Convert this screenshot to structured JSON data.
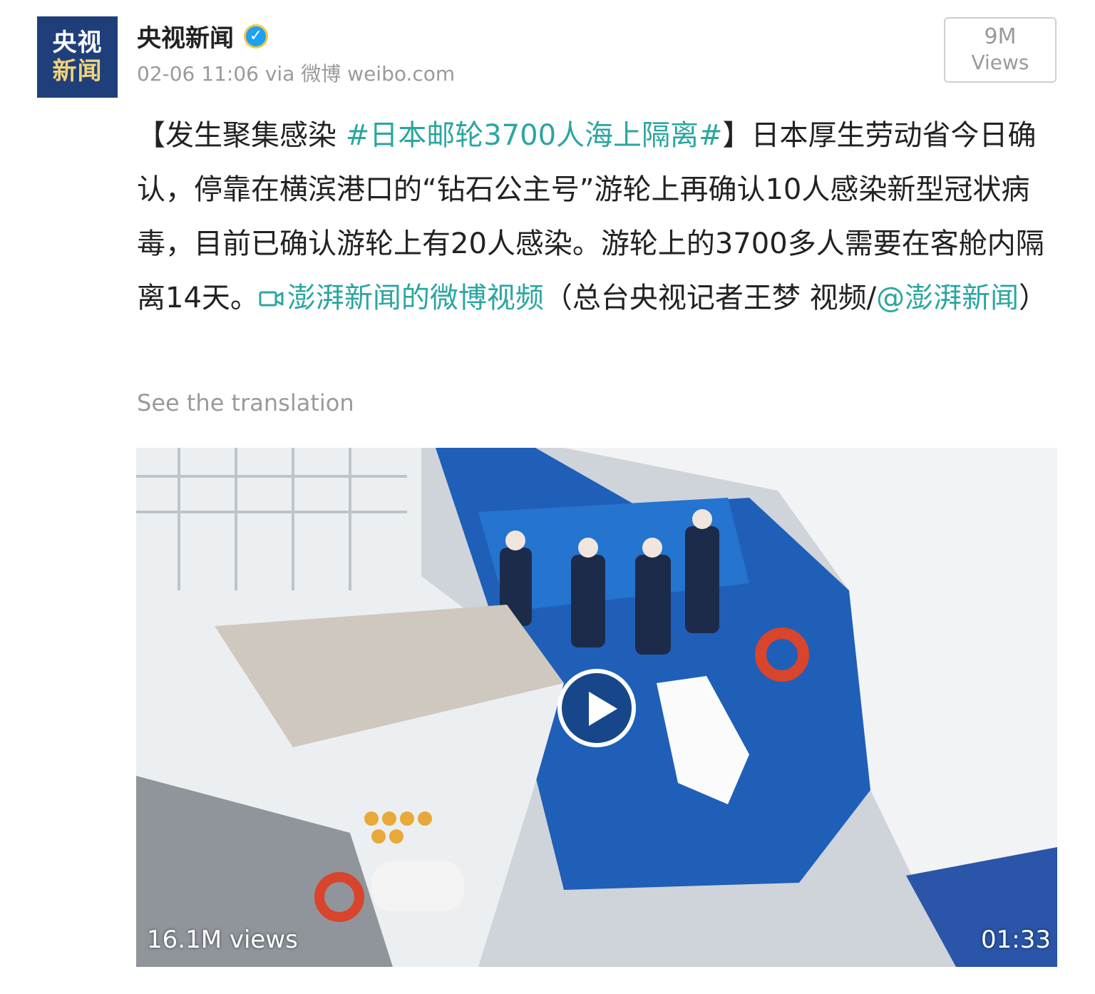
{
  "author": {
    "avatar_line1": "央视",
    "avatar_line2": "新闻",
    "name": "央视新闻",
    "verified_mark": "✓"
  },
  "meta": {
    "timestamp": "02-06 11:06",
    "via": "via 微博 weibo.com"
  },
  "views_box": {
    "count": "9M",
    "label": "Views"
  },
  "post": {
    "bracket_open": "【发生聚集感染 ",
    "hashtag": "#日本邮轮3700人海上隔离#",
    "bracket_close": "】",
    "body1": "日本厚生劳动省今日确认，停靠在横滨港口的“钻石公主号”游轮上再确认10人感染新型冠状病毒，目前已确认游轮上有20人感染。游轮上的3700多人需要在客舱内隔离14天。",
    "video_link_icon": "video-link-icon",
    "video_link": "澎湃新闻的微博视频",
    "body2": "（总台央视记者王梦 视频/",
    "mention": "@澎湃新闻",
    "body3": "）"
  },
  "translate_label": "See the translation",
  "video": {
    "views": "16.1M views",
    "duration": "01:33"
  },
  "colors": {
    "link": "#2ba6a0",
    "muted": "#9a9a9a",
    "avatar_bg": "#1f3f7a"
  }
}
